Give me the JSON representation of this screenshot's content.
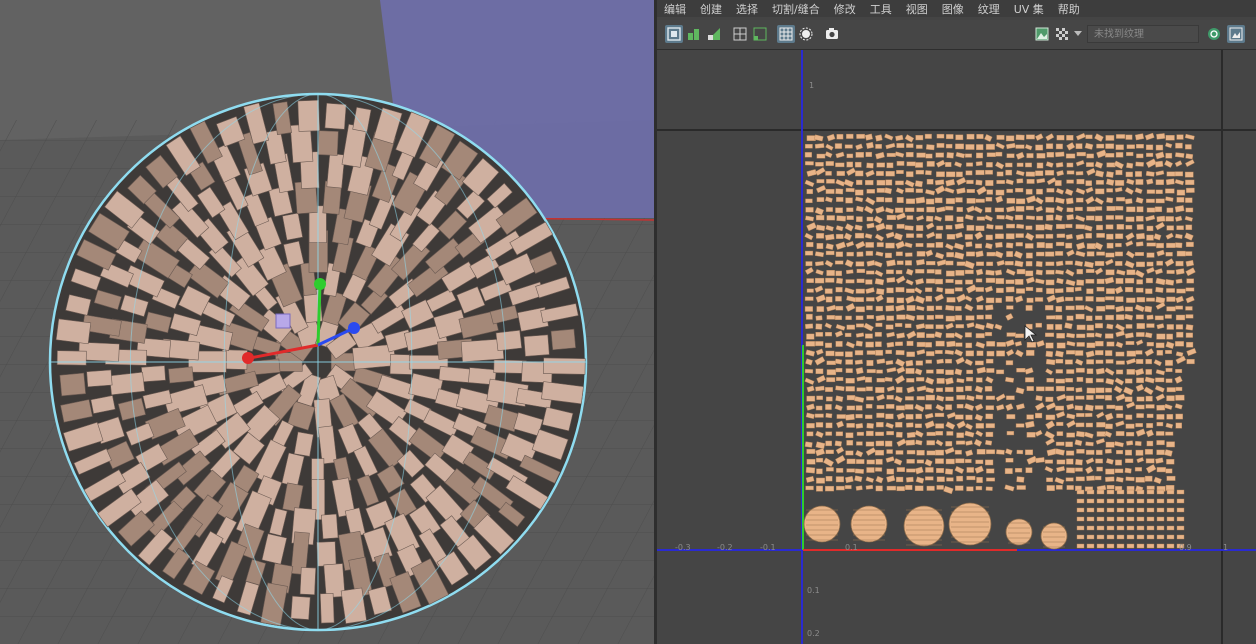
{
  "uv_editor": {
    "menu": [
      "编辑",
      "创建",
      "选择",
      "切割/缝合",
      "修改",
      "工具",
      "视图",
      "图像",
      "纹理",
      "UV 集",
      "帮助"
    ],
    "texture_dropdown_placeholder": "未找到纹理",
    "axis_labels": {
      "v_upper": "1",
      "v_lower_1": "0.1",
      "v_lower_2": "0.2",
      "u_neg_3": "-0.3",
      "u_neg_2": "-0.2",
      "u_neg_1": "-0.1",
      "u_1": "0.1",
      "u_9": "0.9",
      "u_10": "1"
    }
  },
  "colors": {
    "viewport_bg": "#5e5e5e",
    "grid": "#4b4b4b",
    "wire_highlight": "#8fdcf0",
    "face": "#cfb0a0",
    "uv_shell": "#e8b488",
    "uv_bg": "#454545",
    "u_axis": "#2a2ad0",
    "v_axis": "#2a2ad0",
    "accent_x": "#e02a2a",
    "accent_y": "#2ecc2e",
    "accent_z": "#2a4af0"
  },
  "icons": [
    "uv-display-icon",
    "checker-icon",
    "texture-icon",
    "grid-icon",
    "snapshot-icon",
    "image-icon",
    "dropdown-arrow-icon",
    "sync-icon",
    "settings-icon"
  ]
}
